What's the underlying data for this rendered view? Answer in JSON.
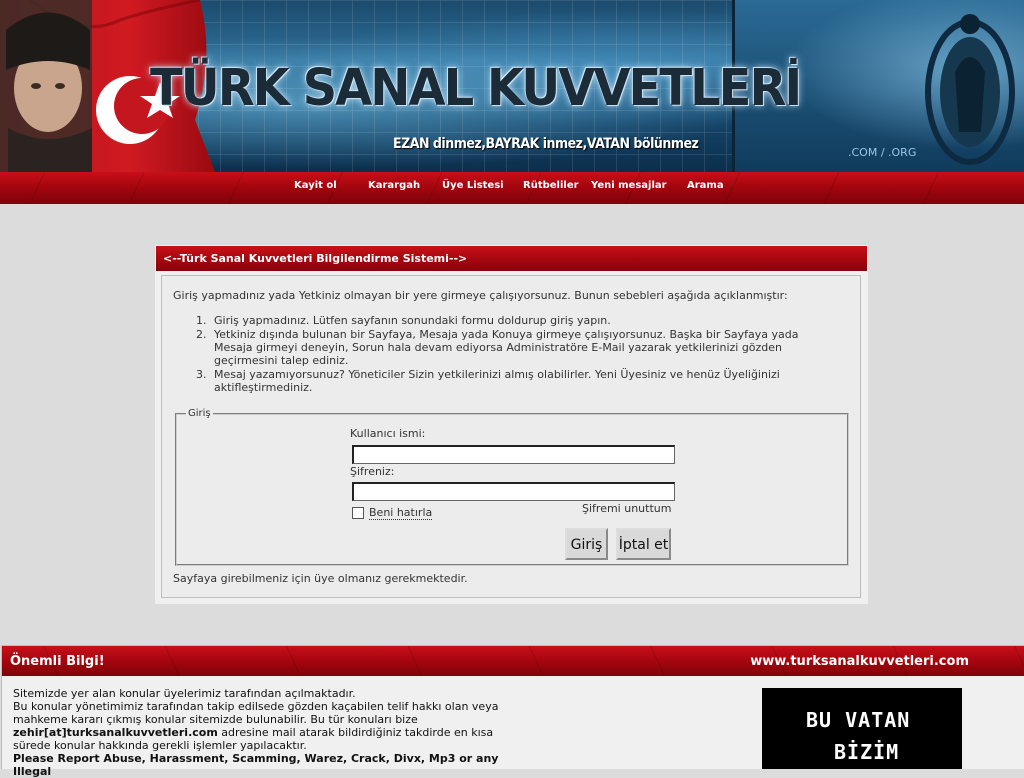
{
  "banner": {
    "title": "TÜRK SANAL KUVVETLERİ",
    "slogan": "EZAN dinmez,BAYRAK inmez,VATAN bölünmez",
    "domains": ".COM / .ORG"
  },
  "nav": {
    "items": [
      "Kayit ol",
      "Karargah",
      "Üye Listesi",
      "Rütbeliler",
      "Yeni mesajlar",
      "Arama"
    ]
  },
  "login": {
    "header": "<--Türk Sanal Kuvvetleri Bilgilendirme Sistemi-->",
    "intro": "Giriş yapmadınız yada Yetkiniz olmayan bir yere girmeye çalışıyorsunuz. Bunun sebebleri aşağıda açıklanmıştır:",
    "reasons": [
      {
        "num": "1.",
        "text": "Giriş yapmadınız. Lütfen sayfanın sonundaki formu doldurup giriş yapın."
      },
      {
        "num": "2.",
        "line1": "Yetkiniz dışında bulunan bir Sayfaya, Mesaja yada Konuya girmeye çalışıyorsunuz. Başka bir Sayfaya yada",
        "line2": "Mesaja girmeyi deneyin, Sorun hala devam ediyorsa Administratöre E-Mail yazarak yetkilerinizi gözden",
        "line3": "geçirmesini talep ediniz."
      },
      {
        "num": "3.",
        "line1": "Mesaj yazamıyorsunuz? Yöneticiler Sizin yetkilerinizi almış olabilirler. Yeni Üyesiniz ve henüz Üyeliğinizi",
        "line2": "aktifleştirmediniz."
      }
    ],
    "legend": "Giriş",
    "username_label": "Kullanıcı ismi:",
    "username_value": "",
    "password_label": "Şifreniz:",
    "password_value": "",
    "remember_label": "Beni hatırla",
    "forgot_label": "Şifremi unuttum",
    "submit_label": "Giriş",
    "cancel_label": "İptal et",
    "note": "Sayfaya girebilmeniz için üye olmanız gerekmektedir."
  },
  "info": {
    "title": "Önemli Bilgi!",
    "site": "www.turksanalkuvvetleri.com",
    "line1": "Sitemizde yer alan konular üyelerimiz tarafından açılmaktadır.",
    "line2": "Bu konular yönetimimiz tarafından takip edilsede gözden kaçabilen telif hakkı olan veya",
    "line3": "mahkeme kararı çıkmış konular sitemizde bulunabilir. Bu tür konuları bize",
    "email": "zehir[at]turksanalkuvvetleri.com",
    "line4_rest": " adresine mail atarak bildirdiğiniz takdirde en kısa",
    "line5": "sürede konular hakkında gerekli işlemler yapılacaktır.",
    "line6": "Please Report Abuse, Harassment, Scamming, Warez, Crack, Divx, Mp3 or any Illegal",
    "badge_line1": "BU VATAN",
    "badge_line2": "BİZİM"
  }
}
